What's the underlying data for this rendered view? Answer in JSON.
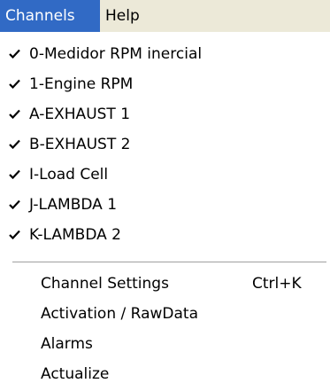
{
  "menubar": {
    "channels_label": "Channels",
    "help_label": "Help"
  },
  "channels_menu": {
    "check_icon": "checkmark-icon",
    "channel_items": [
      {
        "label": "0-Medidor RPM inercial",
        "checked": true
      },
      {
        "label": "1-Engine RPM",
        "checked": true
      },
      {
        "label": "A-EXHAUST 1",
        "checked": true
      },
      {
        "label": "B-EXHAUST 2",
        "checked": true
      },
      {
        "label": "I-Load Cell",
        "checked": true
      },
      {
        "label": "J-LAMBDA 1",
        "checked": true
      },
      {
        "label": "K-LAMBDA 2",
        "checked": true
      }
    ],
    "command_items": [
      {
        "label": "Channel Settings",
        "shortcut": "Ctrl+K"
      },
      {
        "label": "Activation / RawData"
      },
      {
        "label": "Alarms"
      },
      {
        "label": "Actualize"
      }
    ]
  },
  "colors": {
    "menubar_bg": "#ece9d8",
    "highlight_bg": "#316ac5",
    "highlight_text": "#ffffff",
    "menu_bg": "#ffffff"
  }
}
